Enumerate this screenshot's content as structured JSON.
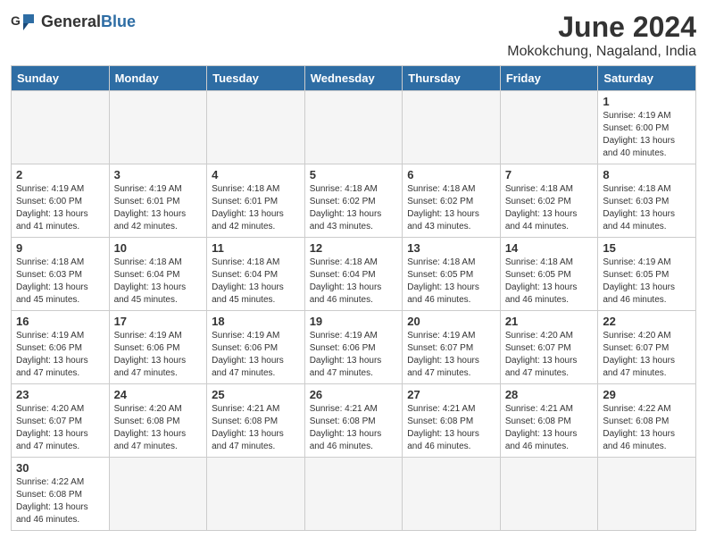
{
  "logo": {
    "text_general": "General",
    "text_blue": "Blue"
  },
  "title": "June 2024",
  "subtitle": "Mokokchung, Nagaland, India",
  "days_of_week": [
    "Sunday",
    "Monday",
    "Tuesday",
    "Wednesday",
    "Thursday",
    "Friday",
    "Saturday"
  ],
  "weeks": [
    [
      null,
      null,
      null,
      null,
      null,
      null,
      {
        "day": "1",
        "sunrise": "4:19 AM",
        "sunset": "6:00 PM",
        "daylight_h": "13",
        "daylight_m": "40"
      }
    ],
    [
      {
        "day": "2",
        "sunrise": "4:19 AM",
        "sunset": "6:00 PM",
        "daylight_h": "13",
        "daylight_m": "41"
      },
      {
        "day": "3",
        "sunrise": "4:19 AM",
        "sunset": "6:01 PM",
        "daylight_h": "13",
        "daylight_m": "42"
      },
      {
        "day": "4",
        "sunrise": "4:18 AM",
        "sunset": "6:01 PM",
        "daylight_h": "13",
        "daylight_m": "42"
      },
      {
        "day": "5",
        "sunrise": "4:18 AM",
        "sunset": "6:02 PM",
        "daylight_h": "13",
        "daylight_m": "43"
      },
      {
        "day": "6",
        "sunrise": "4:18 AM",
        "sunset": "6:02 PM",
        "daylight_h": "13",
        "daylight_m": "43"
      },
      {
        "day": "7",
        "sunrise": "4:18 AM",
        "sunset": "6:02 PM",
        "daylight_h": "13",
        "daylight_m": "44"
      },
      {
        "day": "8",
        "sunrise": "4:18 AM",
        "sunset": "6:03 PM",
        "daylight_h": "13",
        "daylight_m": "44"
      }
    ],
    [
      {
        "day": "9",
        "sunrise": "4:18 AM",
        "sunset": "6:03 PM",
        "daylight_h": "13",
        "daylight_m": "45"
      },
      {
        "day": "10",
        "sunrise": "4:18 AM",
        "sunset": "6:04 PM",
        "daylight_h": "13",
        "daylight_m": "45"
      },
      {
        "day": "11",
        "sunrise": "4:18 AM",
        "sunset": "6:04 PM",
        "daylight_h": "13",
        "daylight_m": "45"
      },
      {
        "day": "12",
        "sunrise": "4:18 AM",
        "sunset": "6:04 PM",
        "daylight_h": "13",
        "daylight_m": "46"
      },
      {
        "day": "13",
        "sunrise": "4:18 AM",
        "sunset": "6:05 PM",
        "daylight_h": "13",
        "daylight_m": "46"
      },
      {
        "day": "14",
        "sunrise": "4:18 AM",
        "sunset": "6:05 PM",
        "daylight_h": "13",
        "daylight_m": "46"
      },
      {
        "day": "15",
        "sunrise": "4:19 AM",
        "sunset": "6:05 PM",
        "daylight_h": "13",
        "daylight_m": "46"
      }
    ],
    [
      {
        "day": "16",
        "sunrise": "4:19 AM",
        "sunset": "6:06 PM",
        "daylight_h": "13",
        "daylight_m": "47"
      },
      {
        "day": "17",
        "sunrise": "4:19 AM",
        "sunset": "6:06 PM",
        "daylight_h": "13",
        "daylight_m": "47"
      },
      {
        "day": "18",
        "sunrise": "4:19 AM",
        "sunset": "6:06 PM",
        "daylight_h": "13",
        "daylight_m": "47"
      },
      {
        "day": "19",
        "sunrise": "4:19 AM",
        "sunset": "6:06 PM",
        "daylight_h": "13",
        "daylight_m": "47"
      },
      {
        "day": "20",
        "sunrise": "4:19 AM",
        "sunset": "6:07 PM",
        "daylight_h": "13",
        "daylight_m": "47"
      },
      {
        "day": "21",
        "sunrise": "4:20 AM",
        "sunset": "6:07 PM",
        "daylight_h": "13",
        "daylight_m": "47"
      },
      {
        "day": "22",
        "sunrise": "4:20 AM",
        "sunset": "6:07 PM",
        "daylight_h": "13",
        "daylight_m": "47"
      }
    ],
    [
      {
        "day": "23",
        "sunrise": "4:20 AM",
        "sunset": "6:07 PM",
        "daylight_h": "13",
        "daylight_m": "47"
      },
      {
        "day": "24",
        "sunrise": "4:20 AM",
        "sunset": "6:08 PM",
        "daylight_h": "13",
        "daylight_m": "47"
      },
      {
        "day": "25",
        "sunrise": "4:21 AM",
        "sunset": "6:08 PM",
        "daylight_h": "13",
        "daylight_m": "47"
      },
      {
        "day": "26",
        "sunrise": "4:21 AM",
        "sunset": "6:08 PM",
        "daylight_h": "13",
        "daylight_m": "46"
      },
      {
        "day": "27",
        "sunrise": "4:21 AM",
        "sunset": "6:08 PM",
        "daylight_h": "13",
        "daylight_m": "46"
      },
      {
        "day": "28",
        "sunrise": "4:21 AM",
        "sunset": "6:08 PM",
        "daylight_h": "13",
        "daylight_m": "46"
      },
      {
        "day": "29",
        "sunrise": "4:22 AM",
        "sunset": "6:08 PM",
        "daylight_h": "13",
        "daylight_m": "46"
      }
    ],
    [
      {
        "day": "30",
        "sunrise": "4:22 AM",
        "sunset": "6:08 PM",
        "daylight_h": "13",
        "daylight_m": "46"
      },
      null,
      null,
      null,
      null,
      null,
      null
    ]
  ]
}
